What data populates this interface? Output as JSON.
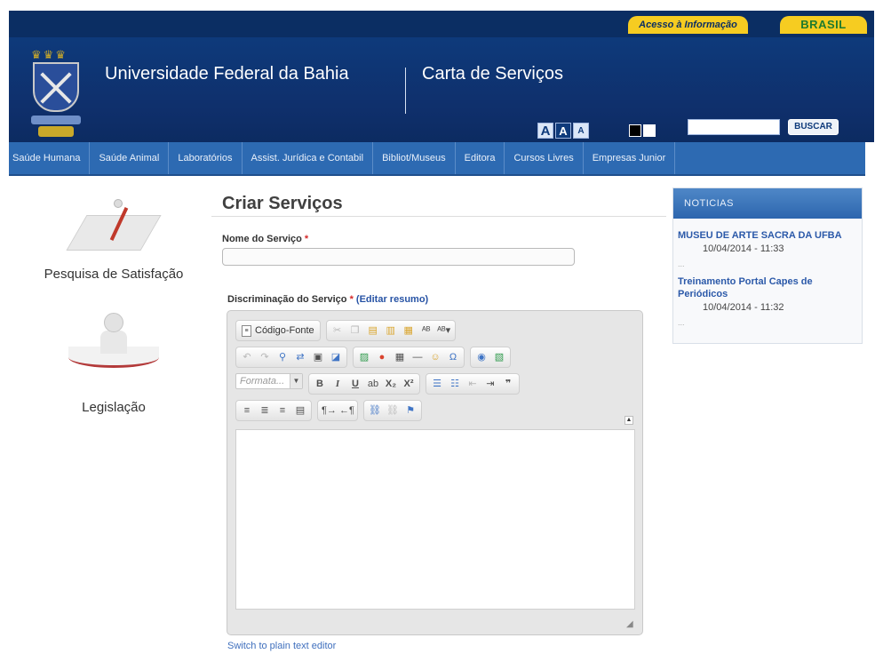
{
  "gov_bar": {
    "access_link": "Acesso à Informação",
    "brasil_link": "BRASIL"
  },
  "header": {
    "university": "Universidade Federal da Bahia",
    "site": "Carta de Serviços",
    "font_large": "A",
    "font_normal": "A",
    "font_small": "A",
    "search_placeholder": "",
    "search_button": "BUSCAR"
  },
  "nav": {
    "items": [
      "Saúde Humana",
      "Saúde Animal",
      "Laboratórios",
      "Assist. Jurídica e Contabil",
      "Bibliot/Museus",
      "Editora",
      "Cursos Livres",
      "Empresas Junior"
    ]
  },
  "left": {
    "promo_1": "Pesquisa de Satisfação",
    "promo_2": "Legislação"
  },
  "main": {
    "title": "Criar Serviços",
    "name_label": "Nome do Serviço",
    "name_required": "*",
    "name_value": "",
    "desc_label": "Discriminação do Serviço",
    "desc_required": "*",
    "desc_link": "(Editar resumo)",
    "source_button": "Código-Fonte",
    "format_placeholder": "Formata...",
    "switch_link": "Switch to plain text editor"
  },
  "news": {
    "header": "NOTICIAS",
    "items": [
      {
        "title": "MUSEU DE ARTE SACRA DA UFBA",
        "date": "10/04/2014 - 11:33",
        "more": "..."
      },
      {
        "title": "Treinamento Portal Capes de Periódicos",
        "date": "10/04/2014 - 11:32",
        "more": "..."
      }
    ]
  },
  "colors": {
    "header_bg": "#0e3a7b",
    "nav_bg": "#2d6ab2",
    "accent_yellow": "#f6cc21",
    "link_blue": "#2b59a9",
    "required_red": "#d42a2a"
  }
}
